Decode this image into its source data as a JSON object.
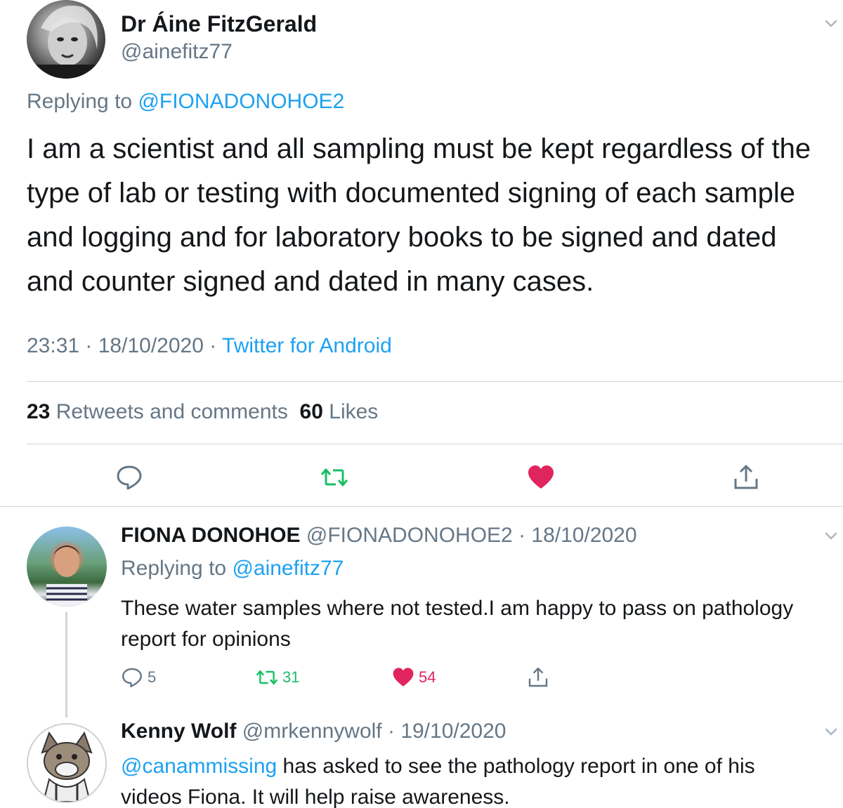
{
  "main_tweet": {
    "display_name": "Dr Áine FitzGerald",
    "handle": "@ainefitz77",
    "replying_prefix": "Replying to ",
    "replying_to": "@FIONADONOHOE2",
    "body_lines": [
      "I am a scientist and all sampling must be kept regardless of the",
      "type of lab or testing with documented signing of each sample",
      "and logging and for laboratory books to be signed and dated",
      "and counter signed and dated in many cases."
    ],
    "time": "23:31",
    "date": "18/10/2020",
    "separator": " · ",
    "source": "Twitter for Android",
    "retweets_count": "23",
    "retweets_label": "Retweets and comments",
    "likes_count": "60",
    "likes_label": "Likes"
  },
  "replies": [
    {
      "display_name": "FIONA DONOHOE",
      "handle": "@FIONADONOHOE2",
      "date": "18/10/2020",
      "replying_prefix": "Replying to ",
      "replying_to": "@ainefitz77",
      "body_lines": [
        "These water samples where not tested.I am happy to pass on pathology",
        "report for opinions"
      ],
      "comments": "5",
      "retweets": "31",
      "likes": "54"
    },
    {
      "display_name": "Kenny Wolf",
      "handle": "@mrkennywolf",
      "date": "19/10/2020",
      "mention": "@canammissing",
      "body_line1_rest": " has asked to see the pathology report in one of his",
      "body_line2": "videos Fiona. It will help raise awareness."
    }
  ],
  "colors": {
    "link_blue": "#1da1f2",
    "muted_grey": "#657786",
    "retweet_green": "#17bf63",
    "like_red": "#e0245e",
    "divider": "#cfd6dc"
  },
  "icons": [
    "chevron-down-icon",
    "comment-icon",
    "retweet-icon",
    "heart-icon",
    "share-icon"
  ]
}
